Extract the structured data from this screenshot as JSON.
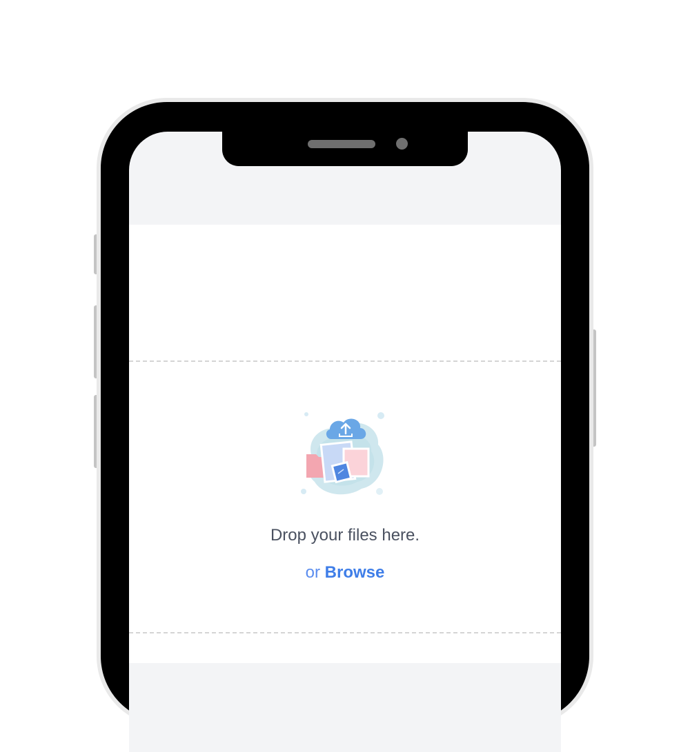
{
  "dropzone": {
    "prompt": "Drop your files here.",
    "or_label": "or",
    "browse_label": "Browse",
    "illustration_icon": "cloud-upload-files-illustration"
  },
  "colors": {
    "link": "#3f7ee8",
    "text": "#4a5160",
    "screen_background": "#f3f4f6"
  }
}
